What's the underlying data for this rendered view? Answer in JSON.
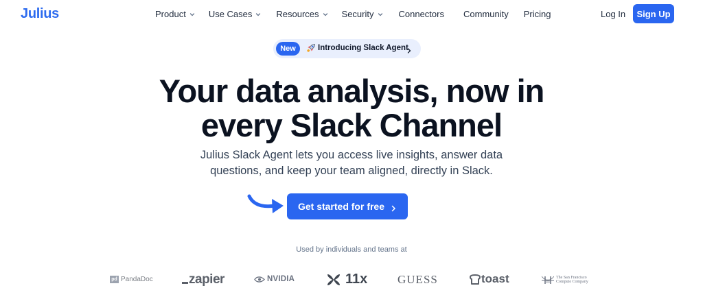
{
  "brand": {
    "name": "Julius",
    "color": "#2d6bef"
  },
  "nav": {
    "items": [
      {
        "label": "Product",
        "dropdown": true
      },
      {
        "label": "Use Cases",
        "dropdown": true
      },
      {
        "label": "Resources",
        "dropdown": true
      },
      {
        "label": "Security",
        "dropdown": true
      },
      {
        "label": "Connectors",
        "dropdown": false
      },
      {
        "label": "Community",
        "dropdown": false
      },
      {
        "label": "Pricing",
        "dropdown": false
      }
    ],
    "login_label": "Log In",
    "signup_label": "Sign Up"
  },
  "announcement": {
    "badge": "New",
    "icon": "rocket-icon",
    "text": "Introducing Slack Agent"
  },
  "hero": {
    "title_line1": "Your data analysis, now in",
    "title_line2": "every Slack Channel",
    "subtitle_line1": "Julius Slack Agent lets you access live insights, answer data",
    "subtitle_line2": "questions, and keep your team aligned, directly in Slack.",
    "cta_label": "Get started for free"
  },
  "social_proof": {
    "caption": "Used by individuals and teams at",
    "logos": {
      "pandadoc": "PandaDoc",
      "pandadoc_mark": "pd",
      "zapier": "zapier",
      "nvidia": "NVIDIA",
      "elevenx": "11x",
      "guess": "GUESS",
      "toast": "toast",
      "sfcc_line1": "The San Francisco",
      "sfcc_line2": "Compute Company"
    }
  },
  "colors": {
    "accent": "#2a66f0",
    "pill_bg": "#e9effd",
    "heading": "#0b1220",
    "body_text": "#334155",
    "muted": "#64748b"
  }
}
